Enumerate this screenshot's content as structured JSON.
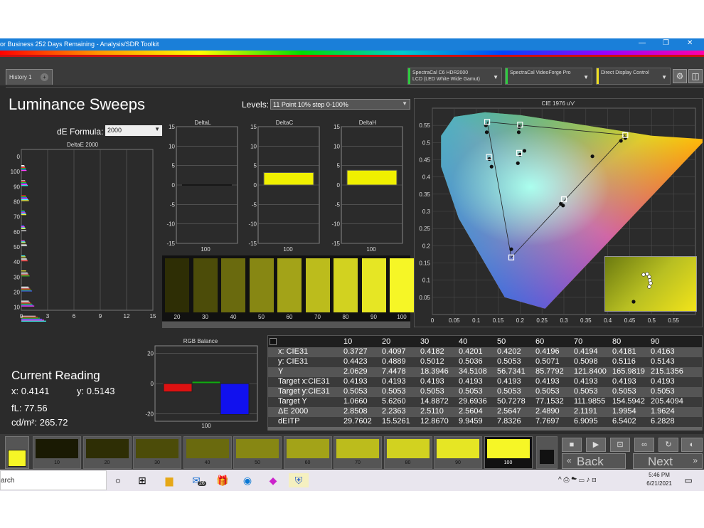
{
  "window": {
    "title": "or Business 252 Days Remaining  - Analysis/SDR Toolkit",
    "minimize": "—",
    "restore": "❐",
    "close": "✕"
  },
  "tabs": {
    "history": "History 1",
    "add": "+"
  },
  "devices": [
    {
      "line1": "SpectraCal C6 HDR2000",
      "line2": "LCD (LED White Wide Gamut)",
      "color": "#2ecc40"
    },
    {
      "line1": "SpectraCal VideoForge Pro",
      "line2": "",
      "color": "#2ecc40"
    },
    {
      "line1": "Direct Display Control",
      "line2": "",
      "color": "#f0e020"
    }
  ],
  "page": {
    "title": "Luminance Sweeps"
  },
  "de_formula": {
    "label": "dE Formula:",
    "value": "2000"
  },
  "levels": {
    "label": "Levels:",
    "value": "11 Point 10% step 0-100%"
  },
  "colors": {
    "yellow": "#f0f000",
    "red": "#dd1111",
    "green": "#11aa11",
    "blue": "#1111ee",
    "bg": "#2b2b2b"
  },
  "chart_data": [
    {
      "type": "bar",
      "title": "DeltaE 2000",
      "orientation": "horizontal",
      "categories": [
        "100",
        "90",
        "80",
        "70",
        "60",
        "50",
        "40",
        "30",
        "20",
        "10",
        "0"
      ],
      "values": [
        6.2828,
        7.7697,
        9.1,
        6.5402,
        6.0,
        6.9095,
        7.7697,
        9.9459,
        12.867,
        15.5261,
        29.7602
      ],
      "xlim": [
        0,
        15
      ],
      "xticks": [
        "0",
        "3",
        "6",
        "9",
        "12",
        "15"
      ],
      "ytick_labels": [
        "0",
        "100",
        "90",
        "80",
        "70",
        "60",
        "50",
        "40",
        "30",
        "20",
        "10"
      ]
    },
    {
      "type": "bar",
      "title": "DeltaL",
      "categories": [
        "100"
      ],
      "values": [
        0
      ],
      "ylim": [
        -15,
        15
      ],
      "yticks": [
        "15",
        "10",
        "5",
        "0",
        "-5",
        "-10",
        "-15"
      ]
    },
    {
      "type": "bar",
      "title": "DeltaC",
      "categories": [
        "100"
      ],
      "values": [
        3.2
      ],
      "ylim": [
        -15,
        15
      ],
      "yticks": [
        "15",
        "10",
        "5",
        "0",
        "-5",
        "-10",
        "-15"
      ]
    },
    {
      "type": "bar",
      "title": "DeltaH",
      "categories": [
        "100"
      ],
      "values": [
        3.8
      ],
      "ylim": [
        -15,
        15
      ],
      "yticks": [
        "15",
        "10",
        "5",
        "0",
        "-5",
        "-10",
        "-15"
      ]
    },
    {
      "type": "bar",
      "title": "RGB Balance",
      "categories": [
        "100"
      ],
      "series": [
        {
          "values": [
            -5.5
          ],
          "color": "#dd1111"
        },
        {
          "values": [
            1.5
          ],
          "color": "#11aa11"
        },
        {
          "values": [
            -20.5
          ],
          "color": "#1111ee"
        }
      ],
      "ylim": [
        -25,
        25
      ],
      "yticks": [
        "20",
        "0",
        "-20"
      ]
    },
    {
      "type": "scatter",
      "title": "CIE 1976 u'v'",
      "xlim": [
        0,
        0.6
      ],
      "ylim": [
        0,
        0.6
      ],
      "xticks": [
        "0",
        "0.05",
        "0.1",
        "0.15",
        "0.2",
        "0.25",
        "0.3",
        "0.35",
        "0.4",
        "0.45",
        "0.5",
        "0.55"
      ],
      "yticks": [
        "0.55",
        "0.5",
        "0.45",
        "0.4",
        "0.35",
        "0.3",
        "0.25",
        "0.2",
        "0.15",
        "0.1",
        "0.05"
      ],
      "targets": [
        {
          "x": 0.125,
          "y": 0.56
        },
        {
          "x": 0.2,
          "y": 0.552
        },
        {
          "x": 0.44,
          "y": 0.522
        },
        {
          "x": 0.18,
          "y": 0.166
        },
        {
          "x": 0.3,
          "y": 0.335
        },
        {
          "x": 0.129,
          "y": 0.458
        },
        {
          "x": 0.198,
          "y": 0.47
        }
      ],
      "measured": [
        {
          "x": 0.122,
          "y": 0.55
        },
        {
          "x": 0.124,
          "y": 0.53
        },
        {
          "x": 0.198,
          "y": 0.545
        },
        {
          "x": 0.197,
          "y": 0.53
        },
        {
          "x": 0.43,
          "y": 0.505
        },
        {
          "x": 0.44,
          "y": 0.513
        },
        {
          "x": 0.365,
          "y": 0.46
        },
        {
          "x": 0.18,
          "y": 0.19
        },
        {
          "x": 0.293,
          "y": 0.322
        },
        {
          "x": 0.298,
          "y": 0.317
        },
        {
          "x": 0.13,
          "y": 0.452
        },
        {
          "x": 0.135,
          "y": 0.43
        },
        {
          "x": 0.195,
          "y": 0.44
        },
        {
          "x": 0.2,
          "y": 0.465
        },
        {
          "x": 0.21,
          "y": 0.476
        }
      ]
    }
  ],
  "swatches": [
    {
      "label": "20",
      "color": "#2e2e05"
    },
    {
      "label": "30",
      "color": "#4c4c09"
    },
    {
      "label": "40",
      "color": "#6a6a0e"
    },
    {
      "label": "50",
      "color": "#878713"
    },
    {
      "label": "60",
      "color": "#a3a318"
    },
    {
      "label": "70",
      "color": "#bcbc1c"
    },
    {
      "label": "80",
      "color": "#d2d220"
    },
    {
      "label": "90",
      "color": "#e6e624"
    },
    {
      "label": "100",
      "color": "#f6f626"
    }
  ],
  "current_reading": {
    "title": "Current Reading",
    "x": "x: 0.4141",
    "y": "y: 0.5143",
    "fl": "fL: 77.56",
    "cd": "cd/m²: 265.72"
  },
  "table": {
    "columns": [
      "10",
      "20",
      "30",
      "40",
      "50",
      "60",
      "70",
      "80",
      "90"
    ],
    "rows": [
      {
        "label": "x: CIE31",
        "values": [
          "0.3727",
          "0.4097",
          "0.4182",
          "0.4201",
          "0.4202",
          "0.4196",
          "0.4194",
          "0.4181",
          "0.4163"
        ]
      },
      {
        "label": "y: CIE31",
        "values": [
          "0.4423",
          "0.4889",
          "0.5012",
          "0.5036",
          "0.5053",
          "0.5071",
          "0.5098",
          "0.5116",
          "0.5143"
        ]
      },
      {
        "label": "Y",
        "values": [
          "2.0629",
          "7.4478",
          "18.3946",
          "34.5108",
          "56.7341",
          "85.7792",
          "121.8400",
          "165.9819",
          "215.1356"
        ]
      },
      {
        "label": "Target x:CIE31",
        "values": [
          "0.4193",
          "0.4193",
          "0.4193",
          "0.4193",
          "0.4193",
          "0.4193",
          "0.4193",
          "0.4193",
          "0.4193"
        ]
      },
      {
        "label": "Target y:CIE31",
        "values": [
          "0.5053",
          "0.5053",
          "0.5053",
          "0.5053",
          "0.5053",
          "0.5053",
          "0.5053",
          "0.5053",
          "0.5053"
        ]
      },
      {
        "label": "Target Y",
        "values": [
          "1.0660",
          "5.6260",
          "14.8872",
          "29.6936",
          "50.7278",
          "77.1532",
          "111.9855",
          "154.5942",
          "205.4094"
        ]
      },
      {
        "label": "ΔE 2000",
        "values": [
          "2.8508",
          "2.2363",
          "2.5110",
          "2.5604",
          "2.5647",
          "2.4890",
          "2.1191",
          "1.9954",
          "1.9624"
        ]
      },
      {
        "label": "dEITP",
        "values": [
          "29.7602",
          "15.5261",
          "12.8670",
          "9.9459",
          "7.8326",
          "7.7697",
          "6.9095",
          "6.5402",
          "6.2828"
        ]
      }
    ]
  },
  "bottom_swatches": [
    {
      "label": "10",
      "color": "#1a1a03"
    },
    {
      "label": "20",
      "color": "#2e2e05"
    },
    {
      "label": "30",
      "color": "#4c4c09"
    },
    {
      "label": "40",
      "color": "#6a6a0e"
    },
    {
      "label": "50",
      "color": "#878713"
    },
    {
      "label": "60",
      "color": "#a3a318"
    },
    {
      "label": "70",
      "color": "#bcbc1c"
    },
    {
      "label": "80",
      "color": "#d2d220"
    },
    {
      "label": "90",
      "color": "#e6e624"
    },
    {
      "label": "100",
      "color": "#f6f626"
    }
  ],
  "nav": {
    "back": "Back",
    "next": "Next"
  },
  "taskbar": {
    "search": "arch",
    "time": "5:46 PM",
    "date": "6/21/2021",
    "mail_badge": "26",
    "tray": "^ ⎙ ☁ ▭ ♪ ⊟"
  }
}
